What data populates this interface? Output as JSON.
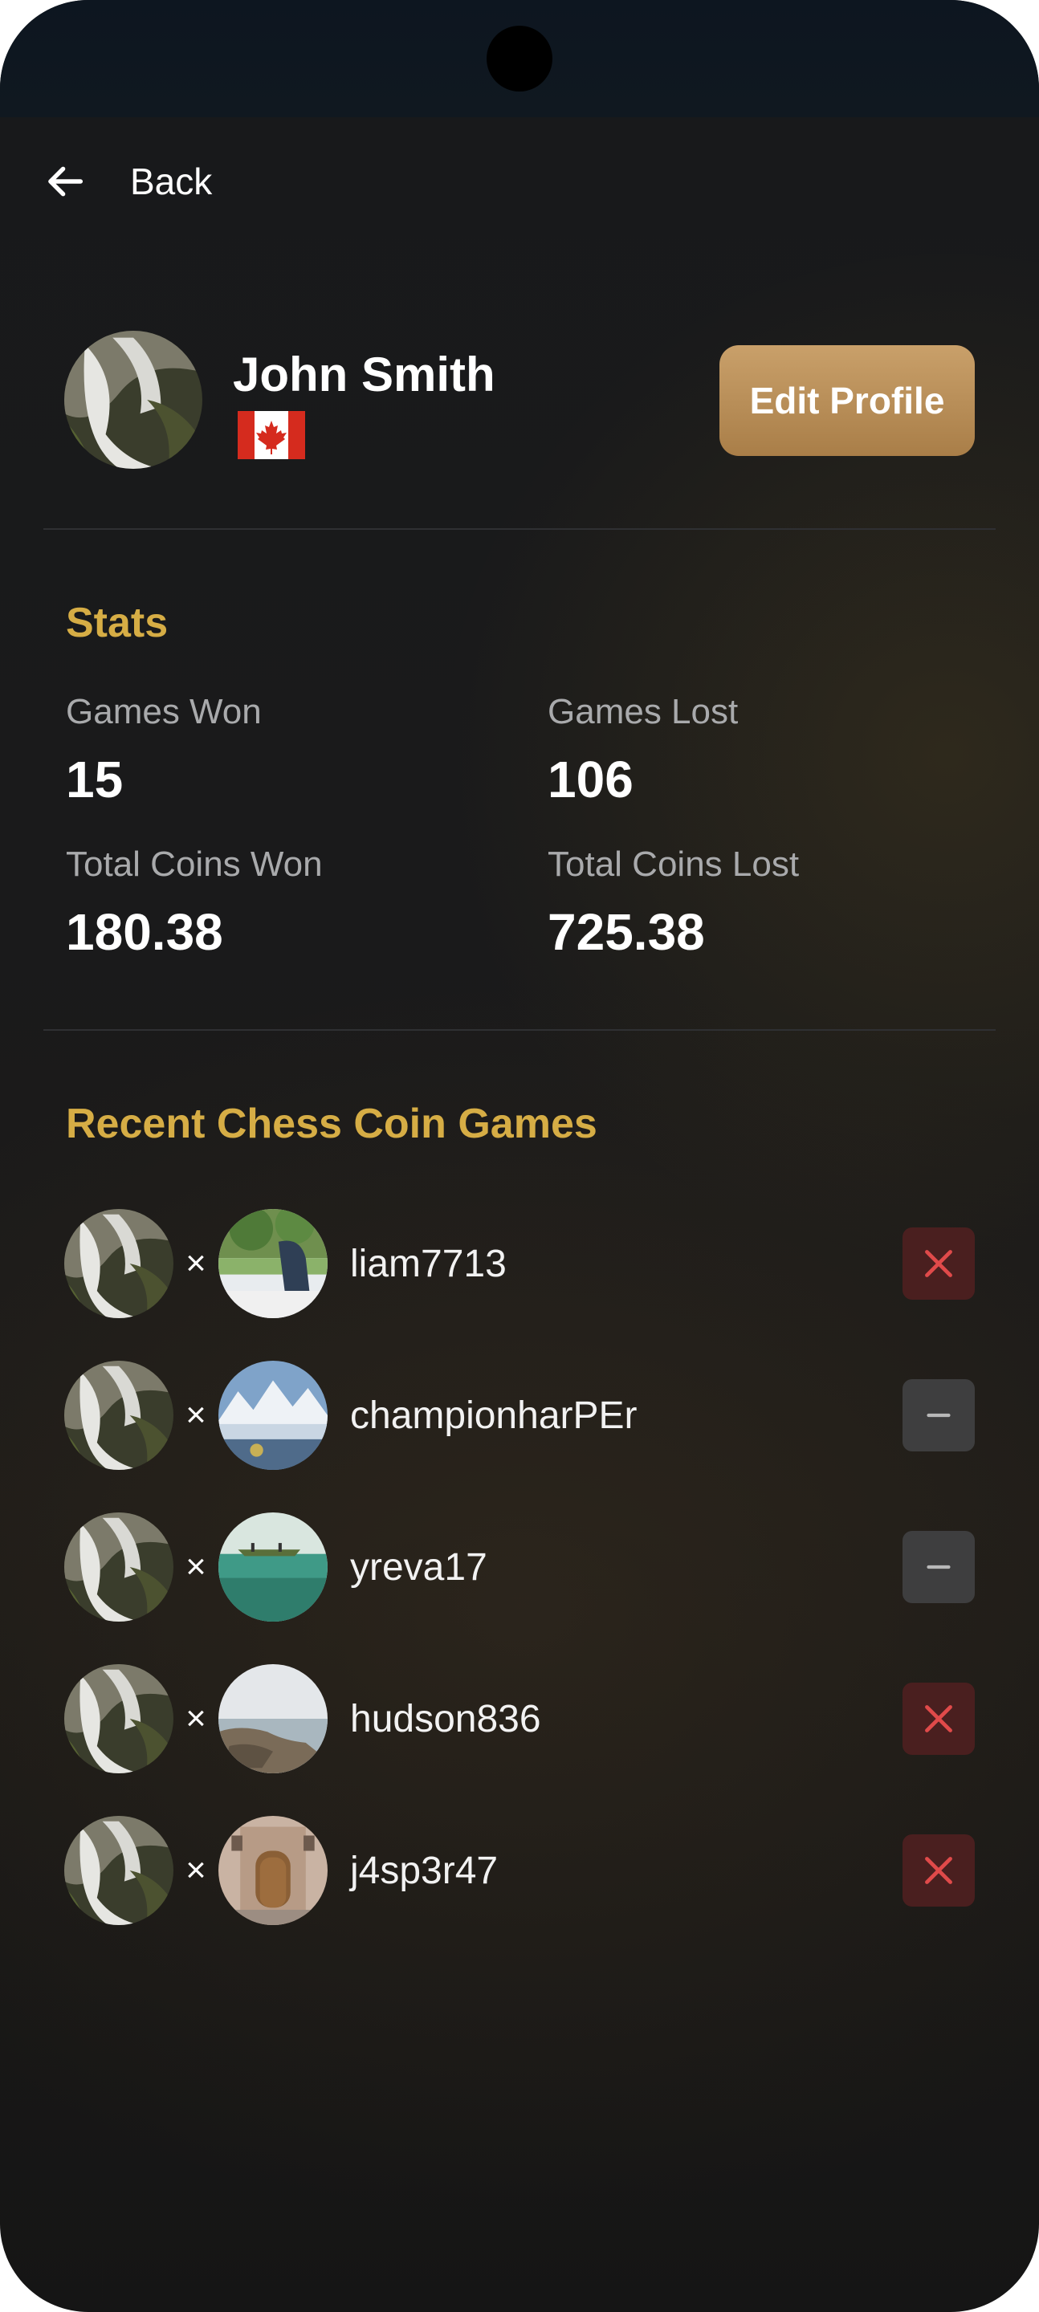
{
  "nav": {
    "back_label": "Back"
  },
  "profile": {
    "name": "John Smith",
    "country_flag": "canada-flag",
    "edit_label": "Edit Profile"
  },
  "stats": {
    "title": "Stats",
    "games_won_label": "Games Won",
    "games_won": "15",
    "games_lost_label": "Games Lost",
    "games_lost": "106",
    "coins_won_label": "Total Coins Won",
    "coins_won": "180.38",
    "coins_lost_label": "Total Coins Lost",
    "coins_lost": "725.38"
  },
  "recent": {
    "title": "Recent Chess Coin Games",
    "vs_symbol": "×",
    "games": [
      {
        "opponent": "liam7713",
        "result": "loss"
      },
      {
        "opponent": "championharPEr",
        "result": "draw"
      },
      {
        "opponent": "yreva17",
        "result": "draw"
      },
      {
        "opponent": "hudson836",
        "result": "loss"
      },
      {
        "opponent": "j4sp3r47",
        "result": "loss"
      }
    ]
  },
  "colors": {
    "accent_gold": "#d6ad45",
    "button_gold": "#b98c55",
    "loss_bg": "#4a1f1f",
    "loss_icon": "#e04a4a",
    "draw_bg": "#3e3e3f"
  },
  "icons": {
    "back": "arrow-left-icon",
    "loss": "close-icon",
    "draw": "minus-icon"
  }
}
